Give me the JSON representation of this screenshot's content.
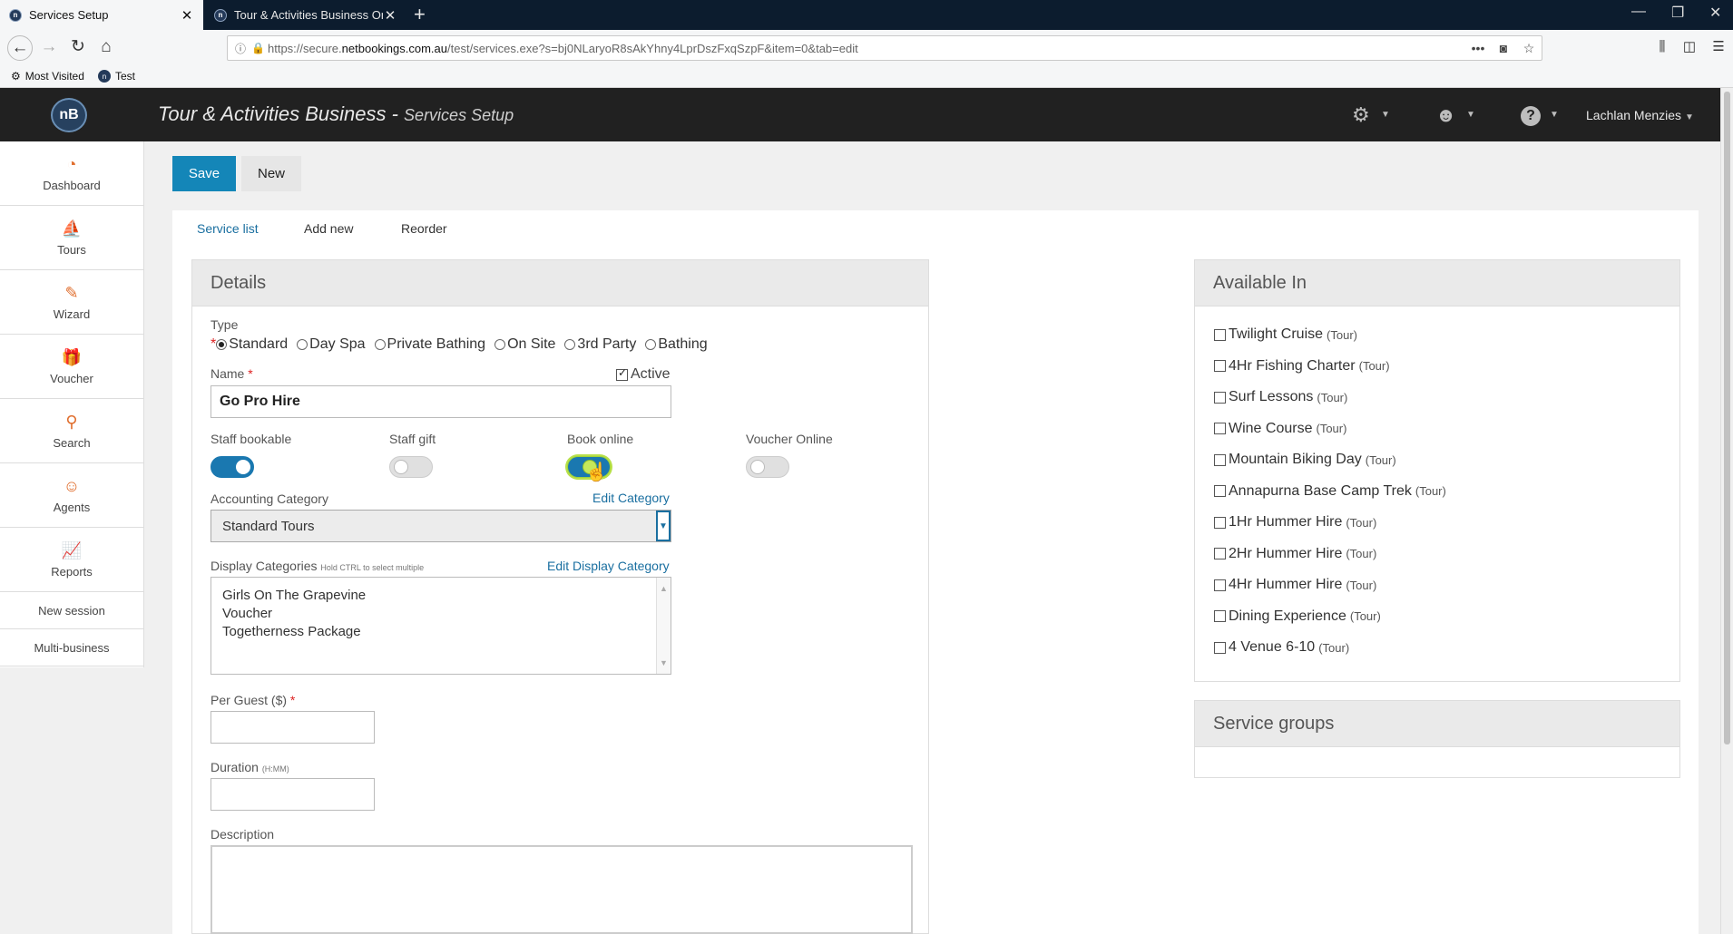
{
  "browser": {
    "tabs": [
      {
        "label": "Services Setup",
        "active": true
      },
      {
        "label": "Tour & Activities Business Onli"
      }
    ],
    "url_prefix": "https://secure.",
    "url_domain": "netbookings.com.au",
    "url_path": "/test/services.exe?s=bj0NLaryoR8sAkYhny4LprDszFxqSzpF&item=0&tab=edit",
    "bookmarks": [
      {
        "label": "Most Visited",
        "icon": "gear-icon"
      },
      {
        "label": "Test",
        "icon": "nb-favicon"
      }
    ]
  },
  "header": {
    "title": "Tour & Activities Business -",
    "subtitle": "Services Setup",
    "user": "Lachlan Menzies",
    "logo": "nB",
    "icons": [
      "settings-icon",
      "user-icon",
      "help-icon"
    ]
  },
  "sidebar": {
    "items": [
      {
        "label": "Dashboard",
        "icon": "dashboard-icon"
      },
      {
        "label": "Tours",
        "icon": "tours-icon"
      },
      {
        "label": "Wizard",
        "icon": "wand-icon"
      },
      {
        "label": "Voucher",
        "icon": "gift-icon"
      },
      {
        "label": "Search",
        "icon": "search-icon"
      },
      {
        "label": "Agents",
        "icon": "agent-icon"
      },
      {
        "label": "Reports",
        "icon": "chart-icon"
      },
      {
        "label": "New session"
      },
      {
        "label": "Multi-business"
      }
    ]
  },
  "toolbar": {
    "save_label": "Save",
    "new_label": "New"
  },
  "tabs": [
    "Service list",
    "Add new",
    "Reorder"
  ],
  "details": {
    "title": "Details",
    "type_label": "Type",
    "type_options": [
      "Standard",
      "Day Spa",
      "Private Bathing",
      "On Site",
      "3rd Party",
      "Bathing"
    ],
    "type_selected": "Standard",
    "name_label": "Name",
    "name_value": "Go Pro Hire",
    "active_label": "Active",
    "active_checked": true,
    "toggles": [
      {
        "label": "Staff bookable",
        "on": true
      },
      {
        "label": "Staff gift",
        "on": false
      },
      {
        "label": "Book online",
        "on": true
      },
      {
        "label": "Voucher Online",
        "on": false
      }
    ],
    "accounting_label": "Accounting Category",
    "edit_category_link": "Edit Category",
    "accounting_value": "Standard Tours",
    "display_label": "Display Categories",
    "display_hint": "Hold CTRL to select multiple",
    "edit_display_link": "Edit Display Category",
    "display_options": [
      "Girls On The Grapevine",
      "Voucher",
      "Togetherness Package"
    ],
    "per_guest_label": "Per Guest ($)",
    "per_guest_value": "",
    "duration_label": "Duration",
    "duration_hint": "(H:MM)",
    "duration_value": "",
    "description_label": "Description",
    "description_value": ""
  },
  "available": {
    "title": "Available In",
    "tag": "(Tour)",
    "items": [
      "Twilight Cruise",
      "4Hr Fishing Charter",
      "Surf Lessons",
      "Wine Course",
      "Mountain Biking Day",
      "Annapurna Base Camp Trek",
      "1Hr Hummer Hire",
      "2Hr Hummer Hire",
      "4Hr Hummer Hire",
      "Dining Experience",
      "4 Venue 6-10"
    ]
  },
  "service_groups": {
    "title": "Service groups"
  },
  "colors": {
    "accent": "#1486b8",
    "header_bg": "#212121",
    "icon_orange": "#e06d2c"
  }
}
